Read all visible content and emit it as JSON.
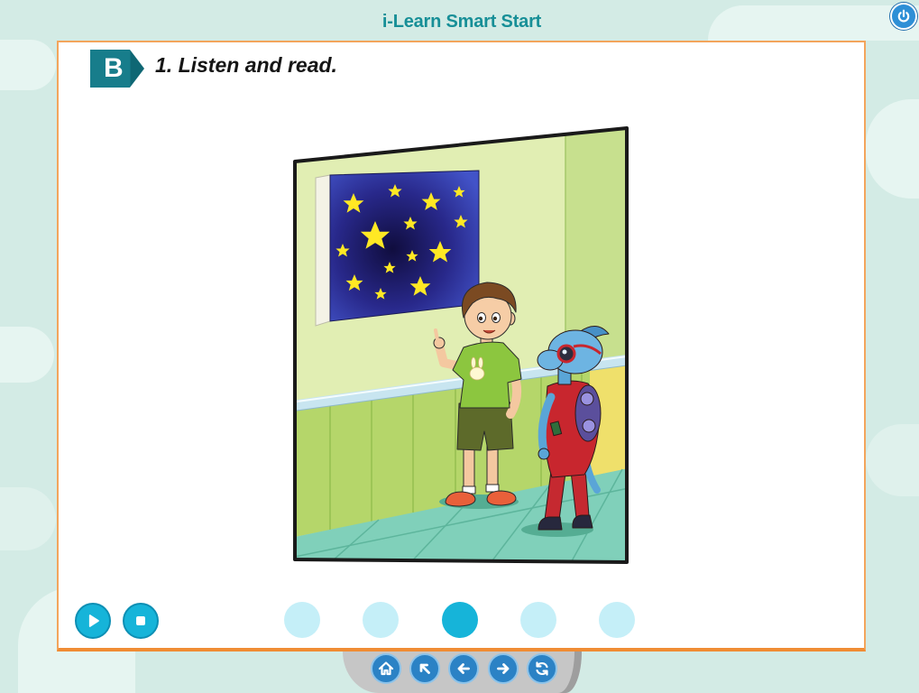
{
  "app": {
    "title": "i-Learn Smart Start",
    "power_icon": "power-icon"
  },
  "exercise": {
    "section_badge": "B",
    "instruction": "1. Listen and read."
  },
  "audio_controls": {
    "play_icon": "play-icon",
    "stop_icon": "stop-icon"
  },
  "page_dots": [
    {
      "active": false
    },
    {
      "active": false
    },
    {
      "active": true
    },
    {
      "active": false
    },
    {
      "active": false
    }
  ],
  "navigation": {
    "buttons": [
      {
        "icon": "home-icon"
      },
      {
        "icon": "arrow-up-left-icon"
      },
      {
        "icon": "previous-arrow-icon"
      },
      {
        "icon": "next-arrow-icon"
      },
      {
        "icon": "refresh-icon"
      }
    ]
  },
  "colors": {
    "background": "#d3ebe5",
    "title": "#178f97",
    "panel_border": "#f3a55c",
    "badge": "#177d8b",
    "accent": "#16b4d9",
    "dot_inactive": "#c5eff8",
    "nav_button": "#2b82c5",
    "power_button": "#2e8fd6"
  }
}
